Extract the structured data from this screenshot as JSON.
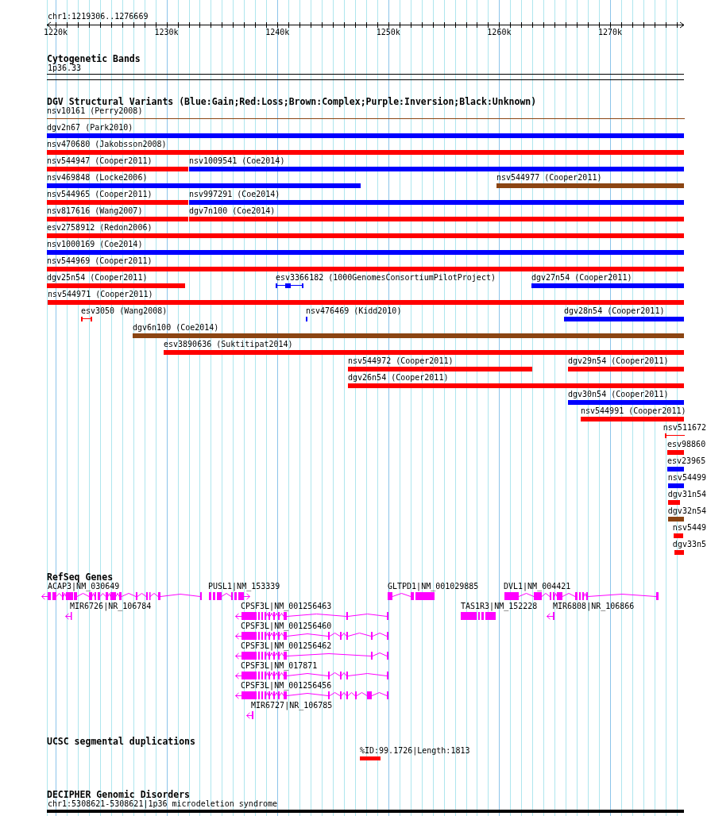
{
  "ruler": {
    "location": "chr1:1219306..1276669",
    "tick_labels": [
      "1220k",
      "1230k",
      "1240k",
      "1250k",
      "1260k",
      "1270k"
    ]
  },
  "cytogenetic_bands": {
    "title": "Cytogenetic Bands",
    "bands": [
      {
        "label": "1p36.33"
      }
    ]
  },
  "dgv_structural_variants": {
    "title": "DGV Structural Variants (Blue:Gain;Red:Loss;Brown:Complex;Purple:Inversion;Black:Unknown)",
    "rows": [
      [
        {
          "label": "nsv10161 (Perry2008)",
          "kind": "line",
          "color": "#8b4513"
        }
      ],
      [
        {
          "label": "dgv2n67 (Park2010)",
          "kind": "bar",
          "color": "#0000ff"
        }
      ],
      [
        {
          "label": "nsv470680 (Jakobsson2008)",
          "kind": "bar",
          "color": "#ff0000"
        }
      ],
      [
        {
          "label": "nsv544947 (Cooper2011)",
          "kind": "bar",
          "color": "#ff0000"
        },
        {
          "label": "nsv1009541 (Coe2014)",
          "kind": "bar",
          "color": "#0000ff"
        }
      ],
      [
        {
          "label": "nsv469848 (Locke2006)",
          "kind": "bar",
          "color": "#0000ff"
        },
        {
          "label": "nsv544977 (Cooper2011)",
          "kind": "bar",
          "color": "#8b4513"
        }
      ],
      [
        {
          "label": "nsv544965 (Cooper2011)",
          "kind": "bar",
          "color": "#ff0000"
        },
        {
          "label": "nsv997291 (Coe2014)",
          "kind": "bar",
          "color": "#0000ff"
        }
      ],
      [
        {
          "label": "nsv817616 (Wang2007)",
          "kind": "bar",
          "color": "#ff0000"
        },
        {
          "label": "dgv7n100 (Coe2014)",
          "kind": "bar",
          "color": "#ff0000"
        }
      ],
      [
        {
          "label": "esv2758912 (Redon2006)",
          "kind": "bar",
          "color": "#ff0000"
        }
      ],
      [
        {
          "label": "nsv1000169 (Coe2014)",
          "kind": "bar",
          "color": "#0000ff"
        }
      ],
      [
        {
          "label": "nsv544969 (Cooper2011)",
          "kind": "bar",
          "color": "#ff0000"
        }
      ],
      [
        {
          "label": "dgv25n54 (Cooper2011)",
          "kind": "bar",
          "color": "#ff0000"
        },
        {
          "label": "esv3366182 (1000GenomesConsortiumPilotProject)",
          "kind": "line",
          "color": "#0000ff"
        },
        {
          "label": "dgv27n54 (Cooper2011)",
          "kind": "bar",
          "color": "#0000ff"
        }
      ],
      [
        {
          "label": "nsv544971 (Cooper2011)",
          "kind": "bar",
          "color": "#ff0000"
        }
      ],
      [
        {
          "label": "esv3050 (Wang2008)",
          "kind": "line",
          "color": "#ff0000"
        },
        {
          "label": "nsv476469 (Kidd2010)",
          "kind": "bar",
          "color": "#0000ff"
        },
        {
          "label": "dgv28n54 (Cooper2011)",
          "kind": "bar",
          "color": "#0000ff"
        }
      ],
      [
        {
          "label": "dgv6n100 (Coe2014)",
          "kind": "bar",
          "color": "#8b4513"
        }
      ],
      [
        {
          "label": "esv3890636 (Suktitipat2014)",
          "kind": "bar",
          "color": "#ff0000"
        }
      ],
      [
        {
          "label": "nsv544972 (Cooper2011)",
          "kind": "bar",
          "color": "#ff0000"
        },
        {
          "label": "dgv29n54 (Cooper2011)",
          "kind": "bar",
          "color": "#ff0000"
        }
      ],
      [
        {
          "label": "dgv26n54 (Cooper2011)",
          "kind": "bar",
          "color": "#ff0000"
        }
      ],
      [
        {
          "label": "dgv30n54 (Cooper2011)",
          "kind": "bar",
          "color": "#0000ff"
        }
      ],
      [
        {
          "label": "nsv544991 (Cooper2011)",
          "kind": "bar",
          "color": "#ff0000"
        }
      ],
      [
        {
          "label": "nsv511672",
          "kind": "line",
          "color": "#ff0000"
        }
      ],
      [
        {
          "label": "esv98860",
          "kind": "bar",
          "color": "#ff0000"
        }
      ],
      [
        {
          "label": "esv23965",
          "kind": "bar",
          "color": "#0000ff"
        }
      ],
      [
        {
          "label": "nsv54499",
          "kind": "bar",
          "color": "#0000ff"
        }
      ],
      [
        {
          "label": "dgv31n54",
          "kind": "bar",
          "color": "#ff0000"
        }
      ],
      [
        {
          "label": "dgv32n54",
          "kind": "bar",
          "color": "#8b4513"
        }
      ],
      [
        {
          "label": "nsv5449",
          "kind": "bar",
          "color": "#ff0000"
        }
      ],
      [
        {
          "label": "dgv33n5",
          "kind": "bar",
          "color": "#ff0000"
        }
      ]
    ]
  },
  "refseq_genes": {
    "title": "RefSeq Genes",
    "rows": [
      [
        {
          "label": "ACAP3|NM_030649",
          "kind": "reverse"
        },
        {
          "label": "PUSL1|NM_153339",
          "kind": "forward"
        },
        {
          "label": "GLTPD1|NM_001029885",
          "kind": "plain"
        },
        {
          "label": "DVL1|NM_004421",
          "kind": "plain"
        }
      ],
      [
        {
          "label": "MIR6726|NR_106784",
          "kind": "reverse"
        },
        {
          "label": "CPSF3L|NM_001256463",
          "kind": "reverse"
        },
        {
          "label": "TAS1R3|NM_152228",
          "kind": "plain"
        },
        {
          "label": "MIR6808|NR_106866",
          "kind": "reverse"
        }
      ],
      [
        {
          "label": "CPSF3L|NM_001256460",
          "kind": "reverse"
        }
      ],
      [
        {
          "label": "CPSF3L|NM_001256462",
          "kind": "reverse"
        }
      ],
      [
        {
          "label": "CPSF3L|NM_017871",
          "kind": "reverse"
        }
      ],
      [
        {
          "label": "CPSF3L|NM_001256456",
          "kind": "reverse"
        }
      ],
      [
        {
          "label": "MIR6727|NR_106785",
          "kind": "reverse"
        }
      ]
    ]
  },
  "ucsc_segmental_duplications": {
    "title": "UCSC segmental duplications",
    "features": [
      {
        "label": "%ID:99.1726|Length:1813"
      }
    ]
  },
  "decipher_genomic_disorders": {
    "title": "DECIPHER Genomic Disorders",
    "features": [
      {
        "label": "chr1:5308621-5308621|1p36 microdeletion syndrome"
      }
    ]
  }
}
